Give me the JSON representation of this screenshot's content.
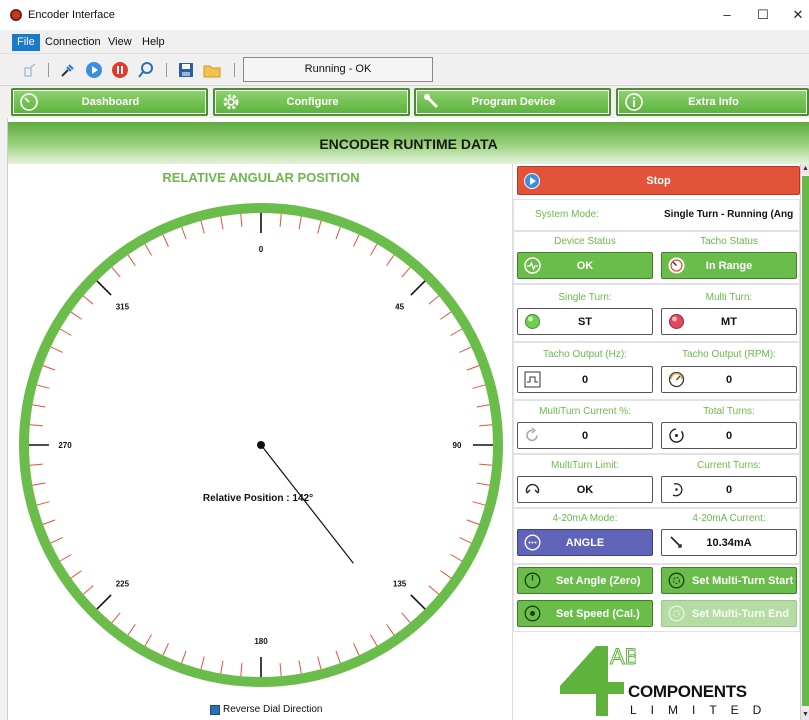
{
  "window": {
    "title": "Encoder Interface",
    "minimize": "–",
    "maximize": "☐",
    "close": "✕"
  },
  "menu": [
    "File",
    "Connection",
    "View",
    "Help"
  ],
  "toolbar": {
    "status": "Running - OK"
  },
  "nav": [
    "Dashboard",
    "Configure",
    "Program Device",
    "Extra Info"
  ],
  "header": {
    "title": "ENCODER RUNTIME DATA"
  },
  "dial": {
    "title": "RELATIVE ANGULAR POSITION",
    "labels": [
      "0",
      "45",
      "90",
      "135",
      "180",
      "225",
      "270",
      "315"
    ],
    "position_text": "Relative Position : 142°",
    "angle_deg": 142,
    "reverse_label": "Reverse Dial Direction"
  },
  "panel": {
    "stop_label": "Stop",
    "system_mode_label": "System Mode:",
    "system_mode_value": "Single Turn - Running (Angl",
    "device_status_label": "Device Status",
    "device_status_value": "OK",
    "tacho_status_label": "Tacho Status",
    "tacho_status_value": "In Range",
    "single_turn_label": "Single Turn:",
    "single_turn_value": "ST",
    "multi_turn_label": "Multi Turn:",
    "multi_turn_value": "MT",
    "tacho_hz_label": "Tacho Output (Hz):",
    "tacho_hz_value": "0",
    "tacho_rpm_label": "Tacho Output (RPM):",
    "tacho_rpm_value": "0",
    "mt_current_label": "MultiTurn Current %:",
    "mt_current_value": "0",
    "total_turns_label": "Total Turns:",
    "total_turns_value": "0",
    "mt_limit_label": "MultiTurn Limit:",
    "mt_limit_value": "OK",
    "current_turns_label": "Current Turns:",
    "current_turns_value": "0",
    "ma_mode_label": "4-20mA Mode:",
    "ma_mode_value": "ANGLE",
    "ma_current_label": "4-20mA Current:",
    "ma_current_value": "10.34mA",
    "set_angle_label": "Set Angle (Zero)",
    "set_mt_start_label": "Set Multi-Turn Start",
    "set_speed_label": "Set Speed (Cal.)",
    "set_mt_end_label": "Set Multi-Turn End"
  },
  "logo": {
    "letters": "AB",
    "company": "COMPONENTS",
    "suffix": "LIMITED"
  },
  "colors": {
    "accent_green": "#6bbd4b",
    "stop_red": "#e2533a",
    "mode_purple": "#5f64b8"
  }
}
